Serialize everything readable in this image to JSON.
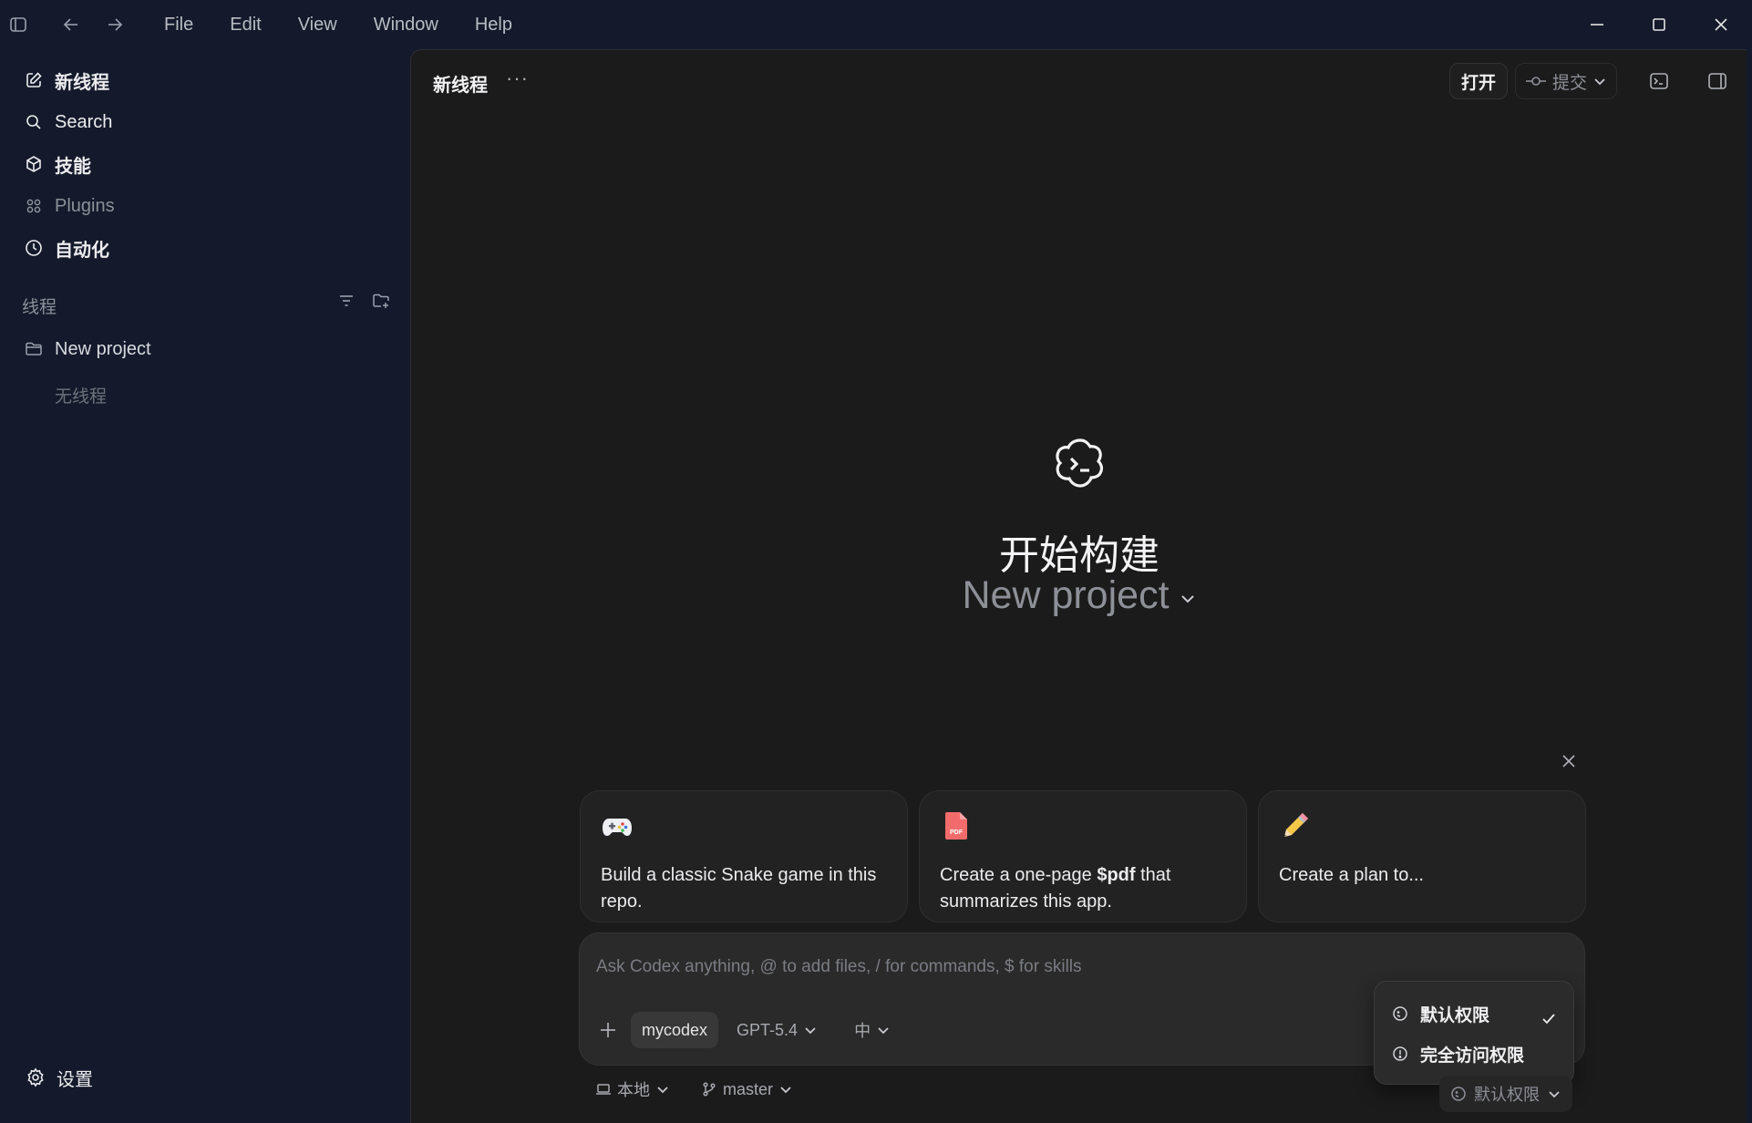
{
  "titlebar": {
    "menu": [
      "File",
      "Edit",
      "View",
      "Window",
      "Help"
    ]
  },
  "sidebar": {
    "nav": [
      {
        "label": "新线程",
        "icon": "edit-icon"
      },
      {
        "label": "Search",
        "icon": "search-icon"
      },
      {
        "label": "技能",
        "icon": "cube-icon"
      },
      {
        "label": "Plugins",
        "icon": "grid-icon"
      },
      {
        "label": "自动化",
        "icon": "clock-icon"
      }
    ],
    "section_title": "线程",
    "project": "New project",
    "empty": "无线程",
    "settings": "设置"
  },
  "main": {
    "thread_title": "新线程",
    "more": "···",
    "open_button": "打开",
    "commit_button": "提交",
    "hero_title": "开始构建",
    "hero_project": "New project"
  },
  "suggestions": [
    {
      "icon": "gamepad-icon",
      "text_before": "Build a classic Snake game in this repo.",
      "bold": "",
      "text_after": ""
    },
    {
      "icon": "pdf-icon",
      "text_before": "Create a one-page ",
      "bold": "$pdf",
      "text_after": " that summarizes this app."
    },
    {
      "icon": "pencil-icon",
      "text_before": "Create a plan to...",
      "bold": "",
      "text_after": ""
    }
  ],
  "composer": {
    "placeholder": "Ask Codex anything, @ to add files, / for commands, $ for skills",
    "repo": "mycodex",
    "model": "GPT-5.4",
    "effort": "中"
  },
  "permissions_menu": {
    "items": [
      "默认权限",
      "完全访问权限"
    ],
    "selected": "默认权限"
  },
  "bottom_bar": {
    "location": "本地",
    "branch": "master",
    "permission": "默认权限"
  },
  "colors": {
    "sidebar_bg": "#141a2b",
    "main_bg": "#1b1b1b",
    "card_bg": "#222222",
    "composer_bg": "#2a2a2a"
  }
}
